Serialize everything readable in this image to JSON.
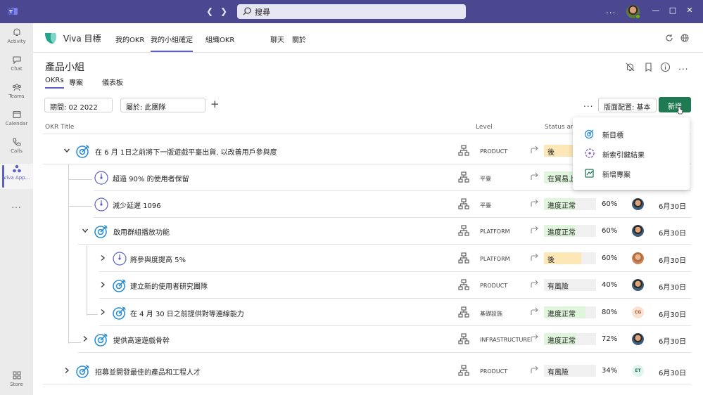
{
  "titlebar": {
    "search_label": "搜尋",
    "more": "..."
  },
  "rail": {
    "items": [
      {
        "label": "Activity",
        "icon": "bell-icon"
      },
      {
        "label": "Chat",
        "icon": "chat-icon"
      },
      {
        "label": "Teams",
        "icon": "teams-icon"
      },
      {
        "label": "Calendar",
        "icon": "calendar-icon"
      },
      {
        "label": "Calls",
        "icon": "phone-icon"
      },
      {
        "label": "Viva App...",
        "icon": "viva-goals-icon"
      }
    ],
    "more": "...",
    "store_label": "Store"
  },
  "app": {
    "name": "Viva 目標",
    "tabs": [
      "我的OKR",
      "我的小組確定",
      "組織OKR",
      "聊天",
      "關於"
    ],
    "active_tab": 1
  },
  "page": {
    "title": "產品小組",
    "subtabs": [
      "OKRs",
      "專案",
      "儀表板"
    ],
    "more": "..."
  },
  "toolbar": {
    "period": "期間: 02 2022",
    "belongs": "屬於: 此團隊",
    "plus": "+",
    "more": "...",
    "layout": "版面配置: 基本",
    "new_label": "新增"
  },
  "columns": {
    "okr_title": "OKR Title",
    "level": "Level",
    "status": "Status and"
  },
  "rows": [
    {
      "title": "在 6 月 1日之前將下一版遊戲平臺出貨, 以改善用戶參與度",
      "level": "PRODUCT",
      "status": "後",
      "pct": "",
      "date": "",
      "avatar": ""
    },
    {
      "title": "超過 90% 的使用者保留",
      "level": "平臺",
      "status": "在貿易上",
      "pct": "",
      "date": "",
      "avatar": ""
    },
    {
      "title": "減少延遲 1096",
      "level": "平臺",
      "status": "進度正常",
      "pct": "60%",
      "date": "6月30日",
      "avatar": ""
    },
    {
      "title": "啟用群組播放功能",
      "level": "PLATFORM",
      "status": "進度正常",
      "pct": "60%",
      "date": "6月30日",
      "avatar": ""
    },
    {
      "title": "將參與度提高 5%",
      "level": "PLATFORM",
      "status": "後",
      "pct": "60%",
      "date": "6月30日",
      "avatar": ""
    },
    {
      "title": "建立新的使用者研究團隊",
      "level": "PRODUCT",
      "status": "有風險",
      "pct": "40%",
      "date": "6月30日",
      "avatar": ""
    },
    {
      "title": "在 4 月 30 日之前提供對等連線能力",
      "level": "基礎設施",
      "status": "進度正常",
      "pct": "80%",
      "date": "6月30日",
      "avatar": "CG"
    },
    {
      "title": "提供高速遊戲骨幹",
      "level": "INFRASTRUCTURE",
      "status": "進度正常",
      "pct": "72%",
      "date": "6月30日",
      "avatar": ""
    },
    {
      "title": "招募並開發最佳的產品和工程人才",
      "level": "PRODUCT",
      "status": "有風險",
      "pct": "34%",
      "date": "6月30日",
      "avatar": "ET"
    }
  ],
  "status_colors": {
    "behind": "#fde7b6",
    "on_track": "#dff6dd",
    "at_risk": "#fde7e9",
    "new_button": "#1f7a53",
    "accent": "#5b5fc7"
  },
  "status_progress": [
    0.7,
    0.6,
    0.6,
    0.6,
    0.72,
    0.0,
    0.8,
    0.62,
    0.0
  ],
  "menu": {
    "items": [
      "新目標",
      "新索引鍵結果",
      "新增專案"
    ]
  }
}
